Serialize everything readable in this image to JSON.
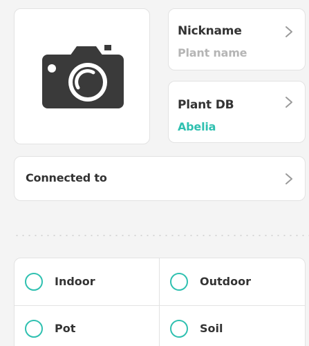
{
  "photo": {
    "icon": "camera-icon"
  },
  "nickname": {
    "title": "Nickname",
    "placeholder": "Plant name",
    "icon": "chevron-right-icon"
  },
  "plant_db": {
    "title": "Plant DB",
    "value": "Abelia",
    "icon": "chevron-right-icon"
  },
  "connected": {
    "title": "Connected to",
    "icon": "chevron-right-icon"
  },
  "location_options": [
    {
      "label": "Indoor",
      "selected": false
    },
    {
      "label": "Outdoor",
      "selected": false
    }
  ],
  "planting_options": [
    {
      "label": "Pot",
      "selected": false
    },
    {
      "label": "Soil",
      "selected": false
    }
  ],
  "colors": {
    "accent": "#2fc0b0",
    "text": "#333333",
    "placeholder": "#b5b5b5",
    "background": "#f4f4f4",
    "card": "#ffffff"
  }
}
